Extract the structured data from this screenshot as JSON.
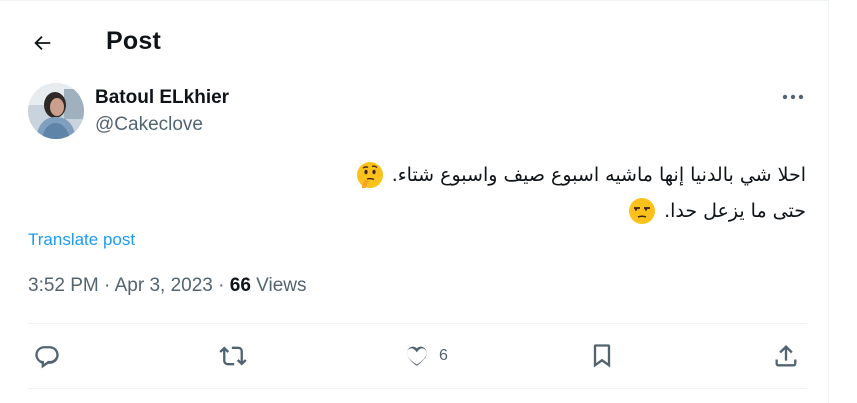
{
  "header": {
    "title": "Post",
    "back_icon": "arrow-left-icon"
  },
  "author": {
    "display_name": "Batoul ELkhier",
    "handle": "@Cakeclove",
    "more_icon": "more-horizontal-icon"
  },
  "post": {
    "lines": [
      {
        "text": "احلا شي بالدنيا إنها ماشيه اسبوع صيف واسبوع شتاء.",
        "emoji": "thinking-face-emoji"
      },
      {
        "text": "حتى ما يزعل حدا.",
        "emoji": "unamused-face-emoji"
      }
    ],
    "translate_label": "Translate post",
    "time": "3:52 PM",
    "separator": "·",
    "date": "Apr 3, 2023",
    "views_count": "66",
    "views_label": "Views"
  },
  "actions": {
    "reply_icon": "reply-icon",
    "repost_icon": "repost-icon",
    "like_icon": "heart-icon",
    "like_count": "6",
    "bookmark_icon": "bookmark-icon",
    "share_icon": "share-icon"
  },
  "colors": {
    "text_primary": "#0f1419",
    "text_secondary": "#536471",
    "link": "#1d9bf0",
    "divider": "#eff3f4"
  }
}
